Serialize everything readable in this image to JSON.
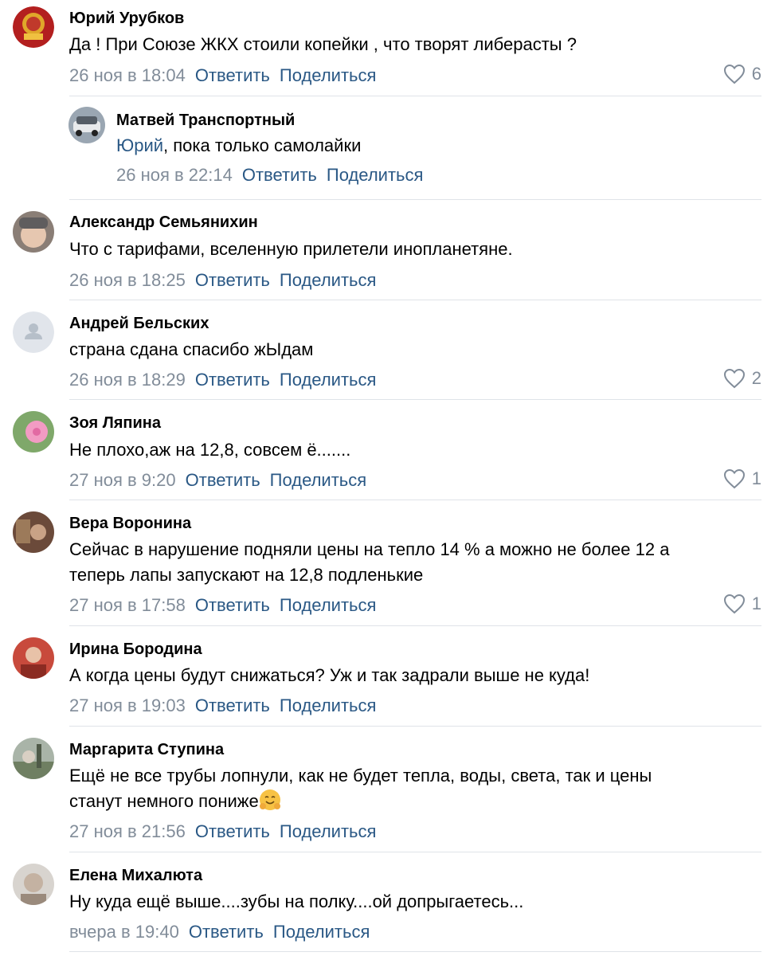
{
  "comments": [
    {
      "author": "Юрий Урубков",
      "text": [
        "Да ! При Союзе ЖКХ стоили копейки , что творят либерасты ?"
      ],
      "date": "26 ноя в 18:04",
      "reply": "Ответить",
      "share": "Поделиться",
      "likes": "6"
    },
    {
      "author": "Матвей Транспортный",
      "mention": "Юрий",
      "text": [
        ", пока только самолайки"
      ],
      "date": "26 ноя в 22:14",
      "reply": "Ответить",
      "share": "Поделиться"
    },
    {
      "author": "Александр Семьянихин",
      "text": [
        "Что с тарифами, вселенную прилетели инопланетяне."
      ],
      "date": "26 ноя в 18:25",
      "reply": "Ответить",
      "share": "Поделиться"
    },
    {
      "author": "Андрей Бельских",
      "text": [
        "страна сдана спасибо жЫдам"
      ],
      "date": "26 ноя в 18:29",
      "reply": "Ответить",
      "share": "Поделиться",
      "likes": "2"
    },
    {
      "author": "Зоя Ляпина",
      "text": [
        "Не плохо,аж на 12,8, совсем ё......."
      ],
      "date": "27 ноя в 9:20",
      "reply": "Ответить",
      "share": "Поделиться",
      "likes": "1"
    },
    {
      "author": "Вера Воронина",
      "text": [
        "Сейчас в нарушение подняли цены на тепло 14 % а можно не более 12 а",
        "теперь лапы запускают на 12,8 подленькие"
      ],
      "date": "27 ноя в 17:58",
      "reply": "Ответить",
      "share": "Поделиться",
      "likes": "1"
    },
    {
      "author": "Ирина Бородина",
      "text": [
        "А когда цены будут снижаться? Уж и так задрали выше не куда!"
      ],
      "date": "27 ноя в 19:03",
      "reply": "Ответить",
      "share": "Поделиться"
    },
    {
      "author": "Маргарита Ступина",
      "text": [
        "Ещё не все трубы лопнули, как не будет тепла, воды, света, так и цены",
        "станут немного пониже"
      ],
      "date": "27 ноя в 21:56",
      "reply": "Ответить",
      "share": "Поделиться"
    },
    {
      "author": "Елена Михалюта",
      "text": [
        "Ну куда ещё выше....зубы на полку....ой допрыгаетесь..."
      ],
      "date": "вчера в 19:40",
      "reply": "Ответить",
      "share": "Поделиться"
    }
  ],
  "colors": {
    "link": "#2a5885",
    "meta": "#818c99",
    "divider": "#dfe3e8"
  }
}
